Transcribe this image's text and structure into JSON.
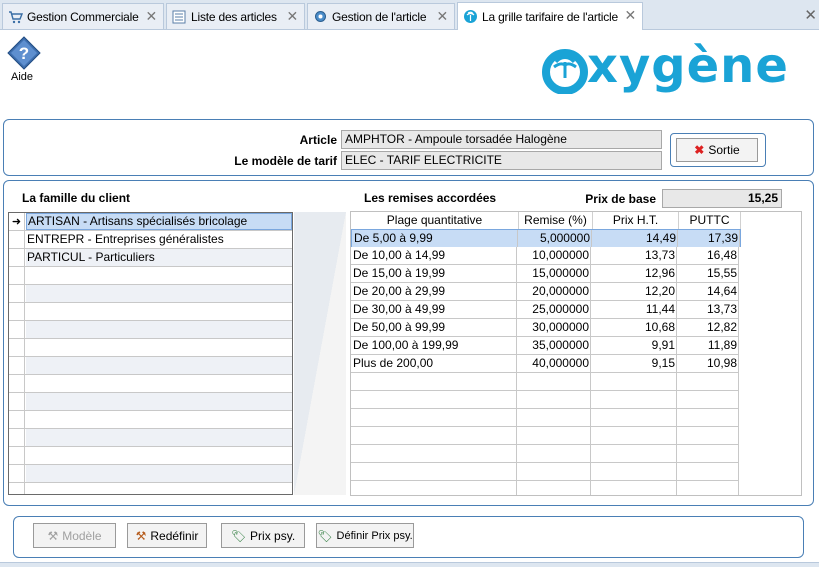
{
  "tabs": [
    {
      "label": "Gestion Commerciale",
      "icon": "cart-icon"
    },
    {
      "label": "Liste des articles",
      "icon": "list-icon"
    },
    {
      "label": "Gestion de l'article",
      "icon": "gear-icon"
    },
    {
      "label": "La grille tarifaire de l'article",
      "icon": "palm-icon"
    }
  ],
  "header": {
    "help_label": "Aide",
    "logo_text": "xygène"
  },
  "article": {
    "article_label": "Article",
    "article_value": "AMPHTOR - Ampoule torsadée Halogène",
    "model_label": "Le modèle de tarif",
    "model_value": "ELEC - TARIF ELECTRICITE",
    "exit_label": "Sortie"
  },
  "families": {
    "title": "La famille du client",
    "rows": [
      "ARTISAN - Artisans spécialisés bricolage",
      "ENTREPR - Entreprises généralistes",
      "PARTICUL - Particuliers"
    ]
  },
  "discounts": {
    "title": "Les remises accordées",
    "base_price_label": "Prix de base",
    "base_price_value": "15,25",
    "columns": [
      "Plage quantitative",
      "Remise (%)",
      "Prix H.T.",
      "PUTTC"
    ],
    "rows": [
      [
        "De 5,00 à 9,99",
        "5,000000",
        "14,49",
        "17,39"
      ],
      [
        "De 10,00 à 14,99",
        "10,000000",
        "13,73",
        "16,48"
      ],
      [
        "De 15,00 à 19,99",
        "15,000000",
        "12,96",
        "15,55"
      ],
      [
        "De 20,00 à 29,99",
        "20,000000",
        "12,20",
        "14,64"
      ],
      [
        "De 30,00 à 49,99",
        "25,000000",
        "11,44",
        "13,73"
      ],
      [
        "De 50,00 à 99,99",
        "30,000000",
        "10,68",
        "12,82"
      ],
      [
        "De 100,00 à 199,99",
        "35,000000",
        "9,91",
        "11,89"
      ],
      [
        "Plus de 200,00",
        "40,000000",
        "9,15",
        "10,98"
      ]
    ]
  },
  "actions": {
    "model": "Modèle",
    "redefine": "Redéfinir",
    "psy_price": "Prix psy.",
    "define_psy_price": "Définir Prix psy."
  },
  "colors": {
    "accent": "#4a7fb5",
    "selection": "#c7dcf5",
    "logo": "#1aa3d6"
  }
}
